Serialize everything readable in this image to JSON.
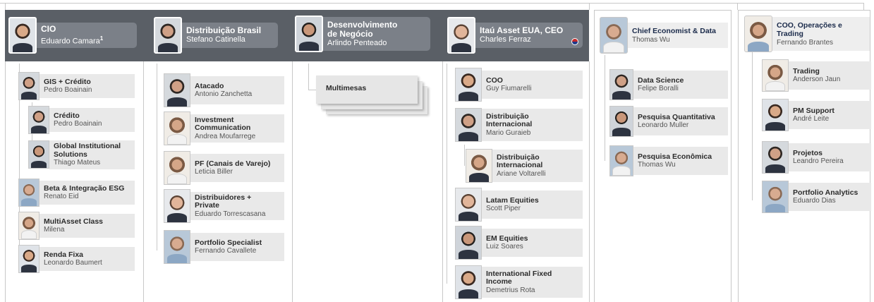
{
  "colors": {
    "band": "#5a5f66",
    "leader_card": "#7b8088",
    "node_card": "#e9e9e9",
    "title_text": "#2b2b2b",
    "name_text": "#555555",
    "connector": "#c8c8c8"
  },
  "leaders": {
    "cio": {
      "title": "CIO",
      "name": "Eduardo Camara",
      "superscript": "1"
    },
    "distribuicao": {
      "title": "Distribuição Brasil",
      "name": "Stefano Catinella"
    },
    "desenvolvimento": {
      "title_line1": "Desenvolvimento",
      "title_line2": "de Negócio",
      "name": "Arlindo Penteado"
    },
    "itau_eua": {
      "title": "Itaú Asset EUA, CEO",
      "name": "Charles Ferraz",
      "flag_icon": "us-flag-icon"
    },
    "economist": {
      "title": "Chief Economist & Data",
      "name": "Thomas Wu"
    },
    "coo": {
      "title_line1": "COO, Operações e",
      "title_line2": "Trading",
      "name": "Fernando Brantes"
    }
  },
  "cio_reports": [
    {
      "title": "GIS + Crédito",
      "name": "Pedro Boainain"
    },
    {
      "title": "Crédito",
      "name": "Pedro Boainain"
    },
    {
      "title_line1": "Global Institutional",
      "title_line2": "Solutions",
      "name": "Thiago Mateus"
    },
    {
      "title": "Beta & Integração ESG",
      "name": "Renato Eid"
    },
    {
      "title": "MultiAsset Class",
      "name": "Milena"
    },
    {
      "title": "Renda Fixa",
      "name": "Leonardo Baumert"
    }
  ],
  "distribuicao_reports": [
    {
      "title": "Atacado",
      "name": "Antonio Zanchetta"
    },
    {
      "title_line1": "Investment",
      "title_line2": "Communication",
      "name": "Andrea Moufarrege"
    },
    {
      "title": "PF (Canais de Varejo)",
      "name": "Leticia Biller"
    },
    {
      "title_line1": "Distribuidores +",
      "title_line2": "Private",
      "name": "Eduardo Torrescasana"
    },
    {
      "title": "Portfolio Specialist",
      "name": "Fernando Cavallete"
    }
  ],
  "desenvolvimento_reports": [
    {
      "title": "Multimesas"
    }
  ],
  "itau_eua_reports": [
    {
      "title": "COO",
      "name": "Guy Fiumarelli"
    },
    {
      "title_line1": "Distribuição",
      "title_line2": "Internacional",
      "name": "Mario Guraieb"
    },
    {
      "title_line1": "Distribuição",
      "title_line2": "Internacional",
      "name": "Ariane Voltarelli"
    },
    {
      "title": "Latam Equities",
      "name": "Scott Piper"
    },
    {
      "title": "EM Equities",
      "name": "Luiz Soares"
    },
    {
      "title_line1": "International Fixed",
      "title_line2": "Income",
      "name": "Demetrius  Rota"
    }
  ],
  "economist_reports": [
    {
      "title": "Data Science",
      "name": "Felipe Boralli"
    },
    {
      "title": "Pesquisa Quantitativa",
      "name": "Leonardo Muller"
    },
    {
      "title": "Pesquisa Econômica",
      "name": "Thomas Wu"
    }
  ],
  "coo_reports": [
    {
      "title": "Trading",
      "name": "Anderson Jaun"
    },
    {
      "title": "PM Support",
      "name": "André Leite"
    },
    {
      "title": "Projetos",
      "name": "Leandro Pereira"
    },
    {
      "title": "Portfolio Analytics",
      "name": "Eduardo Dias"
    }
  ]
}
